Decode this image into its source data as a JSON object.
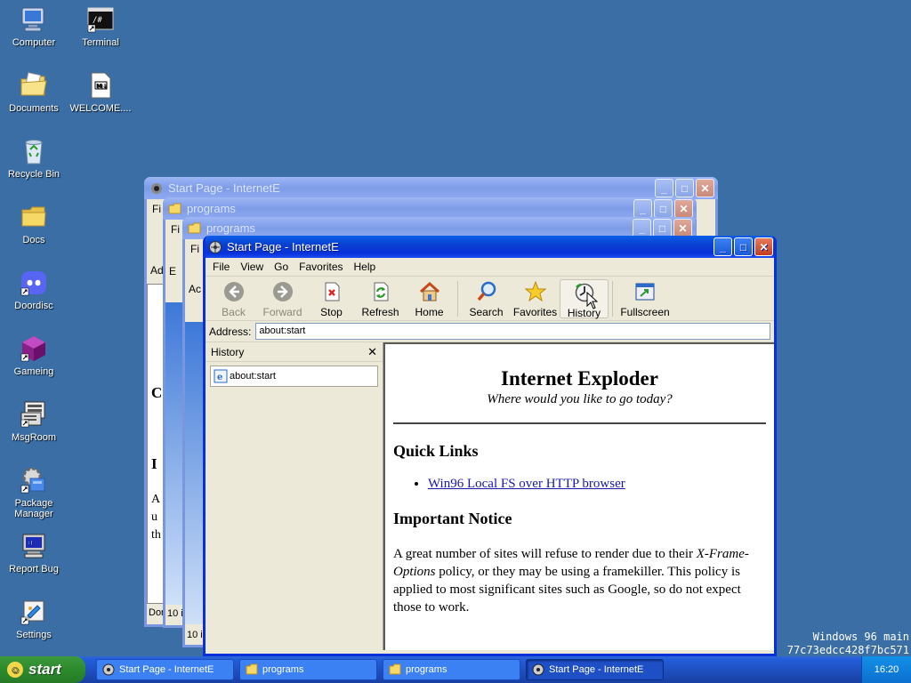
{
  "desktop": {
    "icons": [
      {
        "label": "Computer",
        "icon": "computer-icon"
      },
      {
        "label": "Terminal",
        "icon": "terminal-icon"
      },
      {
        "label": "Documents",
        "icon": "documents-folder-icon"
      },
      {
        "label": "WELCOME....",
        "icon": "markdown-file-icon"
      },
      {
        "label": "Recycle Bin",
        "icon": "recycle-bin-icon"
      },
      {
        "label": "Docs",
        "icon": "folder-icon"
      },
      {
        "label": "Doordisc",
        "icon": "doordisc-icon"
      },
      {
        "label": "Gameing",
        "icon": "cube-icon"
      },
      {
        "label": "MsgRoom",
        "icon": "msgroom-icon"
      },
      {
        "label": "Package Manager",
        "icon": "package-manager-icon"
      },
      {
        "label": "Report Bug",
        "icon": "report-bug-icon"
      },
      {
        "label": "Settings",
        "icon": "settings-icon"
      }
    ],
    "watermark_line1": "Windows 96 main",
    "watermark_line2": "77c73edcc428f7bc571"
  },
  "back_windows": [
    {
      "title": "Start Page - InternetE",
      "menu_first": "Fi",
      "addr": "Ad",
      "status": "Don"
    },
    {
      "title": "programs",
      "menu_first": "Fi",
      "status": "10 i"
    },
    {
      "title": "programs",
      "menu_first": "Fi",
      "status": "10 i"
    }
  ],
  "back_text": {
    "c1": "C",
    "c2": "I",
    "c3": "A",
    "c4": "u",
    "c5": "th",
    "p1": "E",
    "p2": "Ac"
  },
  "main_window": {
    "title": "Start Page - InternetE",
    "menu": [
      "File",
      "View",
      "Go",
      "Favorites",
      "Help"
    ],
    "toolbar": {
      "back": "Back",
      "forward": "Forward",
      "stop": "Stop",
      "refresh": "Refresh",
      "home": "Home",
      "search": "Search",
      "favorites": "Favorites",
      "history": "History",
      "fullscreen": "Fullscreen"
    },
    "address_label": "Address:",
    "address_value": "about:start",
    "history_panel": {
      "title": "History",
      "close": "✕",
      "items": [
        "about:start"
      ]
    },
    "page": {
      "heading": "Internet Exploder",
      "tagline": "Where would you like to go today?",
      "quick_links_heading": "Quick Links",
      "links": [
        "Win96 Local FS over HTTP browser"
      ],
      "notice_heading": "Important Notice",
      "notice_pre": "A great number of sites will refuse to render due to their ",
      "notice_em": "X-Frame-Options",
      "notice_post": " policy, or they may be using a framekiller. This policy is applied to most significant sites such as Google, so do not expect those to work."
    }
  },
  "taskbar": {
    "start_label": "start",
    "tasks": [
      {
        "label": "Start Page - InternetE",
        "icon": "ie-icon",
        "active": false
      },
      {
        "label": "programs",
        "icon": "folder-icon",
        "active": false
      },
      {
        "label": "programs",
        "icon": "folder-icon",
        "active": false
      },
      {
        "label": "Start Page - InternetE",
        "icon": "ie-icon",
        "active": true
      }
    ],
    "clock": "16:20"
  }
}
